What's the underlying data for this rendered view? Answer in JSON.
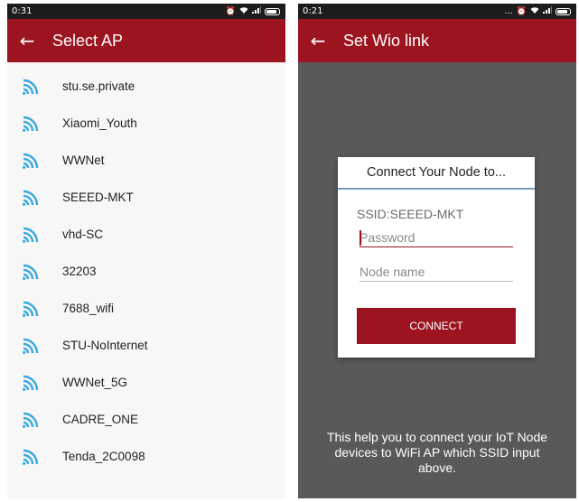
{
  "left_screen": {
    "status": {
      "time": "0:31"
    },
    "app_bar": {
      "title": "Select AP",
      "back_icon": "arrow-left-icon"
    },
    "ap_list": [
      {
        "name": "stu.se.private"
      },
      {
        "name": "Xiaomi_Youth"
      },
      {
        "name": "WWNet"
      },
      {
        "name": "SEEED-MKT"
      },
      {
        "name": "vhd-SC"
      },
      {
        "name": "32203"
      },
      {
        "name": "7688_wifi"
      },
      {
        "name": "STU-NoInternet"
      },
      {
        "name": "WWNet_5G"
      },
      {
        "name": "CADRE_ONE"
      },
      {
        "name": "Tenda_2C0098"
      }
    ],
    "wifi_icon": "wifi-signal-icon"
  },
  "right_screen": {
    "status": {
      "time": "0:21"
    },
    "app_bar": {
      "title": "Set Wio link",
      "back_icon": "arrow-left-icon"
    },
    "dialog": {
      "title": "Connect Your Node to...",
      "ssid_label": "SSID:SEEED-MKT",
      "password": {
        "value": "",
        "placeholder": "Password"
      },
      "node_name": {
        "value": "",
        "placeholder": "Node name"
      },
      "connect_label": "CONNECT"
    },
    "help_text": "This help you to connect your IoT Node devices to WiFi AP which SSID input above."
  },
  "colors": {
    "app_bar": "#9b141f",
    "accent": "#9b141f",
    "wifi_icon": "#3aa9e0",
    "status_bar": "#1c1c1c",
    "overlay": "#595959"
  }
}
